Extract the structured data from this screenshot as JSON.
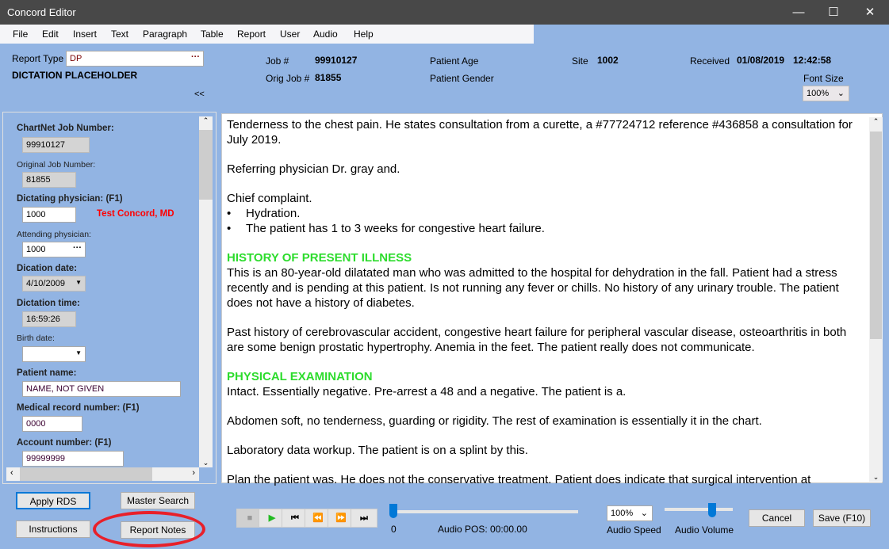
{
  "window": {
    "title": "Concord Editor",
    "minimize": "—",
    "maximize": "☐",
    "close": "✕"
  },
  "menu": [
    "File",
    "Edit",
    "Insert",
    "Text",
    "Paragraph",
    "Table",
    "Report",
    "User",
    "Audio",
    "Help"
  ],
  "header": {
    "report_type_label": "Report Type",
    "report_type_value": "DP",
    "report_type_desc": "DICTATION PLACEHOLDER",
    "collapse": "<<",
    "job_label": "Job #",
    "job_value": "99910127",
    "orig_job_label": "Orig Job #",
    "orig_job_value": "81855",
    "patient_age_label": "Patient Age",
    "patient_gender_label": "Patient Gender",
    "site_label": "Site",
    "site_value": "1002",
    "received_label": "Received",
    "received_date": "01/08/2019",
    "received_time": "12:42:58",
    "font_size_label": "Font Size",
    "font_size_value": "100%"
  },
  "left": {
    "chartnet_label": "ChartNet Job Number:",
    "chartnet_value": "99910127",
    "orig_label": "Original Job Number:",
    "orig_value": "81855",
    "dict_phys_label": "Dictating physician: (F1)",
    "dict_phys_value": "1000",
    "dict_phys_name": "Test Concord, MD",
    "att_phys_label": "Attending physician:",
    "att_phys_value": "1000",
    "dict_date_label": "Dication date:",
    "dict_date_value": "4/10/2009",
    "dict_time_label": "Dictation time:",
    "dict_time_value": "16:59:26",
    "birth_label": "Birth date:",
    "birth_value": "",
    "patient_label": "Patient name:",
    "patient_value": "NAME, NOT GIVEN",
    "mrn_label": "Medical record number: (F1)",
    "mrn_value": "0000",
    "account_label": "Account number: (F1)",
    "account_value": "99999999"
  },
  "document": {
    "p1": "Tenderness to the chest pain.  He states consultation from a curette, a #77724712 reference #436858 a consultation for July 2019.",
    "p2": "Referring physician Dr. gray and.",
    "p3": "Chief complaint.",
    "b1": "Hydration.",
    "b2": "The patient has 1 to 3 weeks for congestive heart failure.",
    "h1": "HISTORY OF PRESENT ILLNESS",
    "p4": "This is an 80-year-old dilatated man who was admitted to the hospital for dehydration in the fall.  Patient had a stress recently and is pending at this patient.  Is not running any fever or chills.  No history of any urinary trouble.  The patient does not have a history of diabetes.",
    "p5": "Past history of cerebrovascular accident, congestive heart failure for peripheral vascular disease, osteoarthritis in both are some benign prostatic hypertrophy.  Anemia in the feet.  The patient really does not communicate.",
    "h2": "PHYSICAL EXAMINATION",
    "p6": "Intact.  Essentially negative.  Pre-arrest a 48 and a negative.  The patient is a.",
    "p7": "Abdomen soft, no tenderness, guarding or rigidity.  The rest of examination is essentially it in the chart.",
    "p8": "Laboratory data workup.  The patient is on a splint by this.",
    "p9": "Plan the patient was.  He does not the conservative treatment.  Patient does indicate that surgical intervention at"
  },
  "footer": {
    "apply_rds": "Apply RDS",
    "master_search": "Master Search",
    "instructions": "Instructions",
    "report_notes": "Report Notes",
    "audio_pos_value": "0",
    "audio_pos": "Audio POS: 00:00.00",
    "audio_speed_value": "100%",
    "audio_speed_label": "Audio Speed",
    "audio_volume_label": "Audio Volume",
    "audio_volume_level": 0.7,
    "cancel": "Cancel",
    "save": "Save (F10)"
  },
  "colors": {
    "background": "#92b4e3",
    "heading_green": "#2ddc2d",
    "physician_red": "#ff0000",
    "highlight_circle": "#e8202a"
  }
}
